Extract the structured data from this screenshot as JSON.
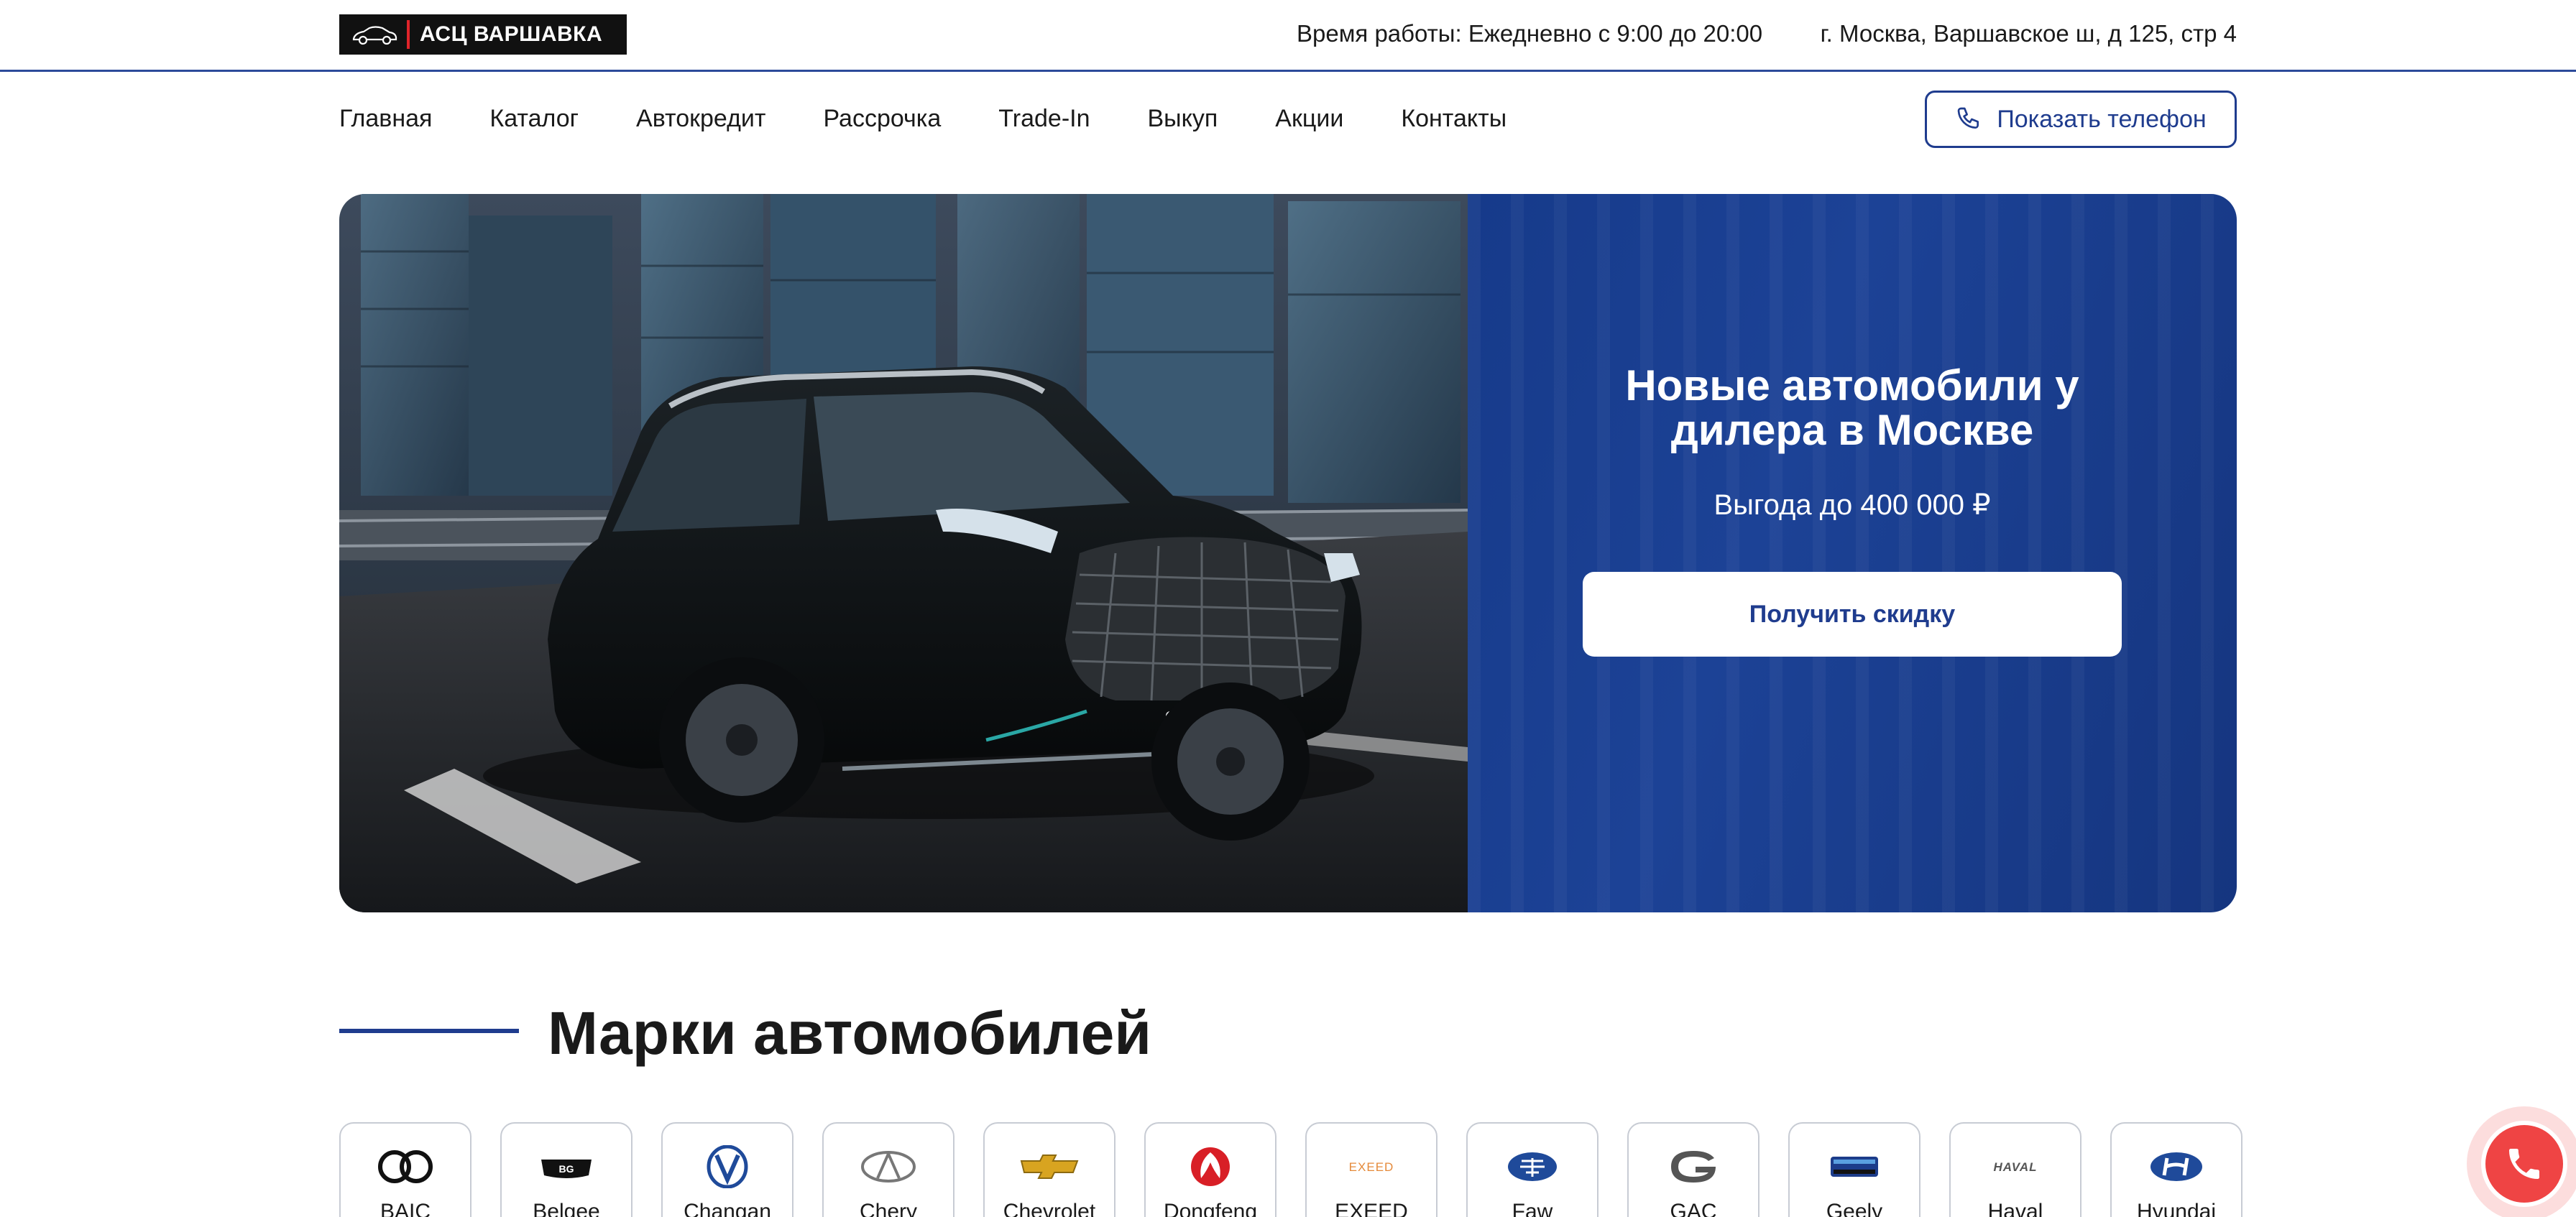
{
  "header": {
    "logo_text": "АСЦ ВАРШАВКА",
    "work_hours": "Время работы: Ежедневно с 9:00 до 20:00",
    "address": "г. Москва, Варшавское ш, д 125, стр 4"
  },
  "nav": {
    "items": [
      "Главная",
      "Каталог",
      "Автокредит",
      "Рассрочка",
      "Trade-In",
      "Выкуп",
      "Акции",
      "Контакты"
    ],
    "phone_button": "Показать телефон"
  },
  "hero": {
    "title": "Новые автомобили у дилера в Москве",
    "subtitle": "Выгода до 400 000 ₽",
    "cta": "Получить скидку"
  },
  "brands_section": {
    "title": "Марки автомобилей",
    "brands": [
      "BAIC",
      "Belgee",
      "Changan",
      "Chery",
      "Chevrolet",
      "Dongfeng",
      "EXEED",
      "Faw",
      "GAC",
      "Geely",
      "Haval",
      "Hyundai"
    ]
  },
  "icons": {
    "phone": "phone-icon",
    "call": "call-icon"
  },
  "colors": {
    "brand_blue": "#1f3c8e",
    "call_red": "#ef4444",
    "logo_bg": "#111111"
  }
}
